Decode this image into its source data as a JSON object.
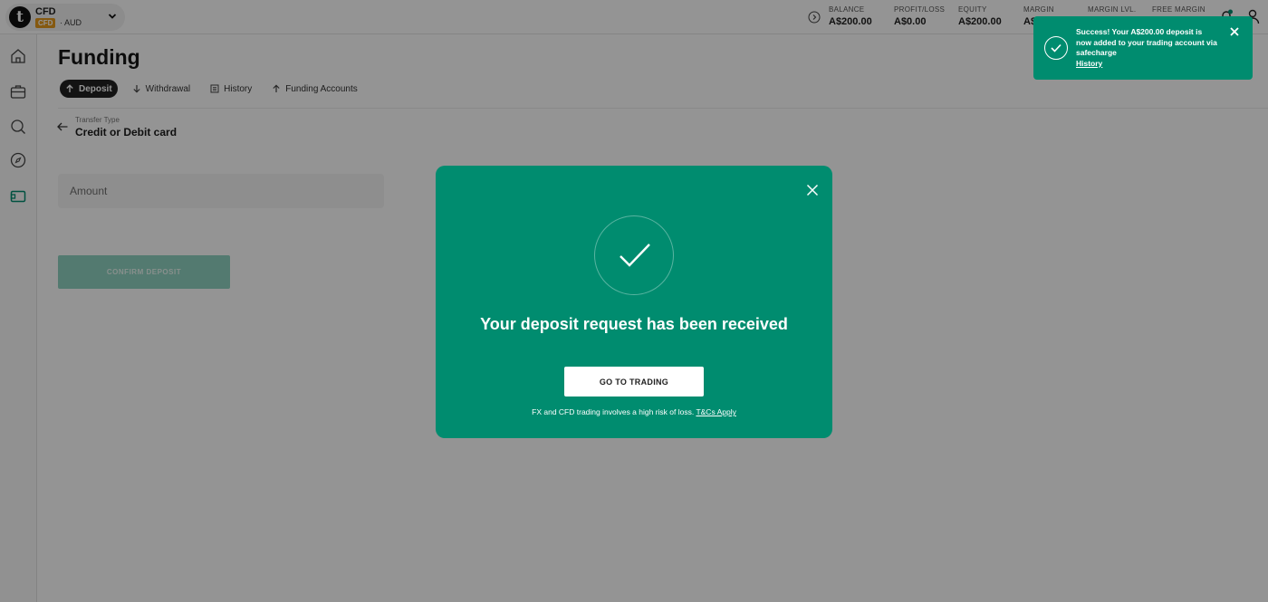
{
  "account": {
    "name": "CFD",
    "badge": "CFD",
    "currency": "· AUD",
    "logo_letter": "t"
  },
  "stats": [
    {
      "label": "BALANCE",
      "value": "A$200.00"
    },
    {
      "label": "PROFIT/LOSS",
      "value": "A$0.00"
    },
    {
      "label": "EQUITY",
      "value": "A$200.00"
    },
    {
      "label": "MARGIN",
      "value": "A$"
    },
    {
      "label": "MARGIN LVL.",
      "value": ""
    },
    {
      "label": "FREE MARGIN",
      "value": ""
    }
  ],
  "page": {
    "title": "Funding",
    "tabs": [
      {
        "label": "Deposit",
        "icon": "arrow-up-icon",
        "active": true
      },
      {
        "label": "Withdrawal",
        "icon": "arrow-down-icon",
        "active": false
      },
      {
        "label": "History",
        "icon": "list-icon",
        "active": false
      },
      {
        "label": "Funding Accounts",
        "icon": "arrow-up-icon",
        "active": false
      }
    ],
    "transfer_type_label": "Transfer Type",
    "transfer_type_value": "Credit or Debit card",
    "amount_placeholder": "Amount",
    "confirm_label": "CONFIRM DEPOSIT"
  },
  "modal": {
    "title": "Your deposit request has been received",
    "button_label": "GO TO TRADING",
    "disclaimer": "FX and CFD trading involves a high risk of loss.",
    "disclaimer_link": "T&Cs Apply"
  },
  "toast": {
    "message": "Success! Your A$200.00 deposit is now added to your trading account via safecharge",
    "link": "History"
  },
  "colors": {
    "brand_green": "#008c6f",
    "badge_orange": "#e69a1c",
    "confirm_disabled": "#8fd3c1"
  }
}
